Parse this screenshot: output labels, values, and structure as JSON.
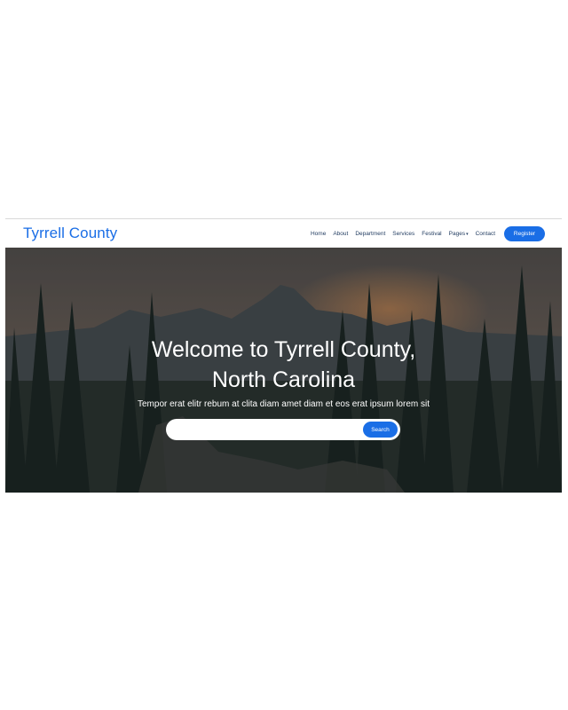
{
  "brand": {
    "title": "Tyrrell County",
    "color": "#1a6ee6"
  },
  "nav": {
    "items": [
      "Home",
      "About",
      "Department",
      "Services",
      "Festival",
      "Pages",
      "Contact"
    ],
    "register_label": "Register"
  },
  "hero": {
    "title_line1": "Welcome to Tyrrell County,",
    "title_line2": "North Carolina",
    "subtitle": "Tempor erat elitr rebum at clita diam amet diam et eos erat ipsum lorem sit",
    "search_placeholder": "",
    "search_label": "Search"
  }
}
